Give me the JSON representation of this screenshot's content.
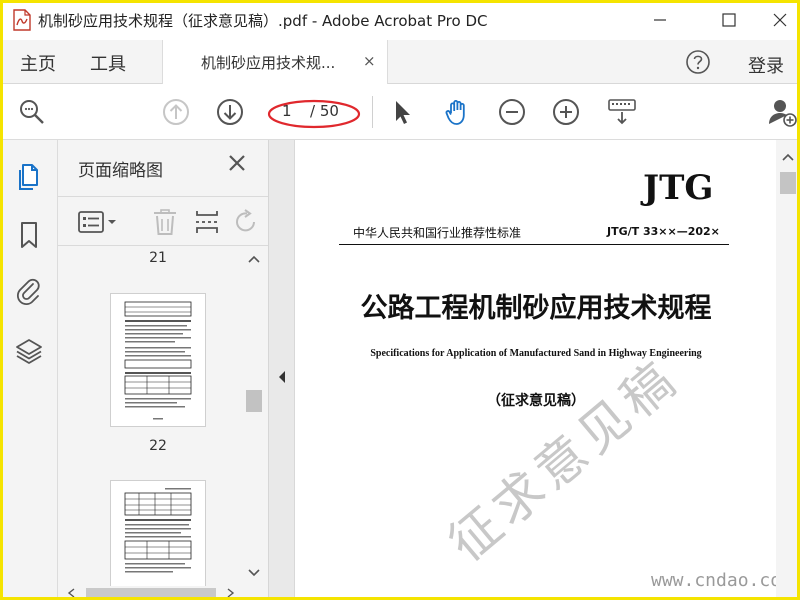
{
  "window": {
    "title": "机制砂应用技术规程（征求意见稿）.pdf - Adobe Acrobat Pro DC"
  },
  "menu": {
    "home": "主页",
    "tools": "工具",
    "doc_tab": "机制砂应用技术规...",
    "doc_tab_close": "×",
    "login": "登录"
  },
  "toolbar": {
    "page_current": "1",
    "page_total": "/ 50",
    "icons": [
      "search-zoom-icon",
      "page-up-icon",
      "page-down-icon",
      "select-arrow-icon",
      "hand-tool-icon",
      "zoom-out-icon",
      "zoom-in-icon",
      "keyboard-scroll-icon",
      "share-user-icon"
    ]
  },
  "thumbnails": {
    "panel_title": "页面缩略图",
    "pages": [
      {
        "label": "21"
      },
      {
        "label": "22"
      }
    ]
  },
  "document": {
    "jtg": "JTG",
    "standard_class": "中华人民共和国行业推荐性标准",
    "standard_code": "JTG/T 33××—202×",
    "title": "公路工程机制砂应用技术规程",
    "subtitle_en": "Specifications for Application of Manufactured Sand in Highway Engineering",
    "draft": "（征求意见稿）",
    "watermark_chars": "征求意见稿",
    "watermark_url": "www.cndao.com"
  },
  "colors": {
    "frame": "#f5e400",
    "accent_blue": "#1a73c8",
    "highlight_red": "#e0282d"
  }
}
